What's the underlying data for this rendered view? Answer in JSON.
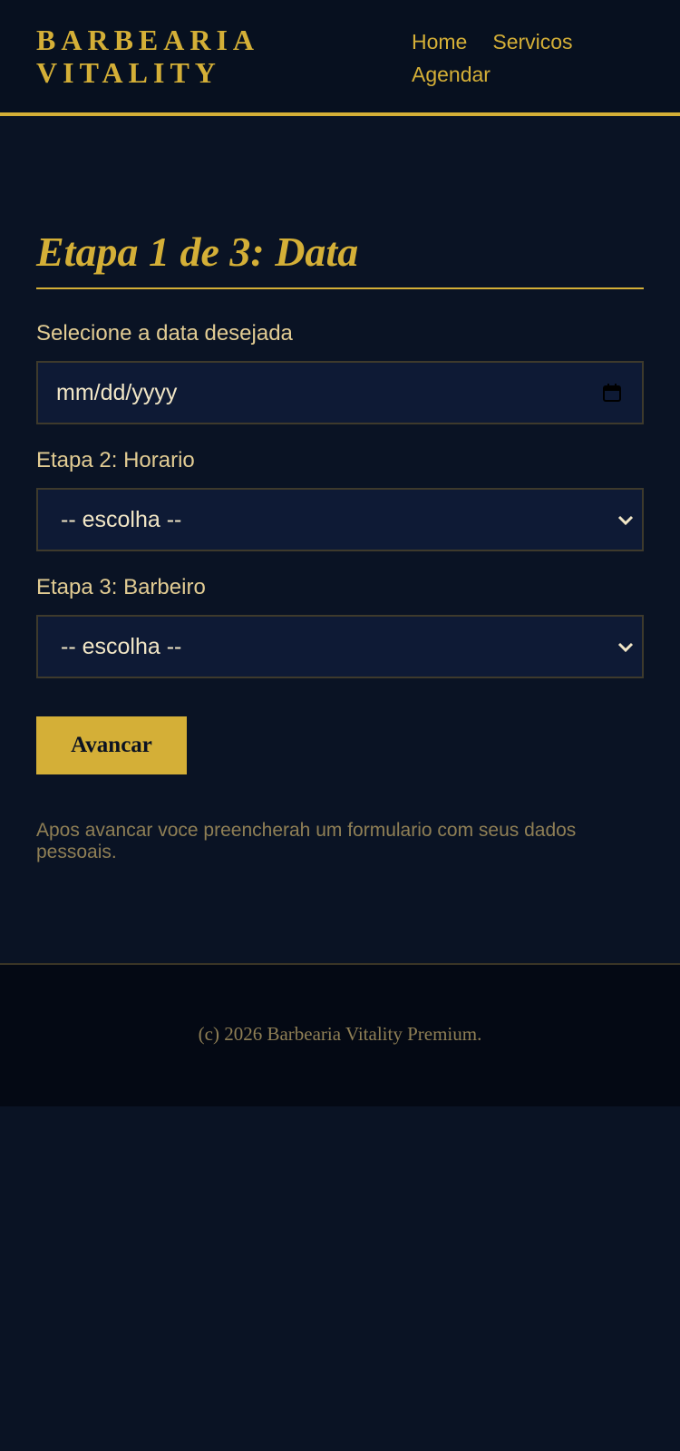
{
  "header": {
    "logo_line1": "BARBEARIA",
    "logo_line2": "VITALITY",
    "nav": [
      "Home",
      "Servicos",
      "Agendar"
    ]
  },
  "main": {
    "title": "Etapa 1 de 3: Data",
    "date_label": "Selecione a data desejada",
    "date_placeholder": "mm/dd/yyyy",
    "horario_label": "Etapa 2: Horario",
    "horario_value": "-- escolha --",
    "barbeiro_label": "Etapa 3: Barbeiro",
    "barbeiro_value": "-- escolha --",
    "submit_label": "Avancar",
    "note": "Apos avancar voce preencherah um formulario com seus dados pessoais."
  },
  "footer": {
    "copyright": "(c) 2026 Barbearia Vitality Premium."
  },
  "colors": {
    "accent": "#d4af37",
    "background": "#0a1324",
    "header_bg": "#07101f",
    "field_bg": "#0e1a35",
    "footer_bg": "#040914"
  },
  "icons": {
    "date_field": "calendar-icon",
    "select_fields": "chevron-down-icon"
  }
}
